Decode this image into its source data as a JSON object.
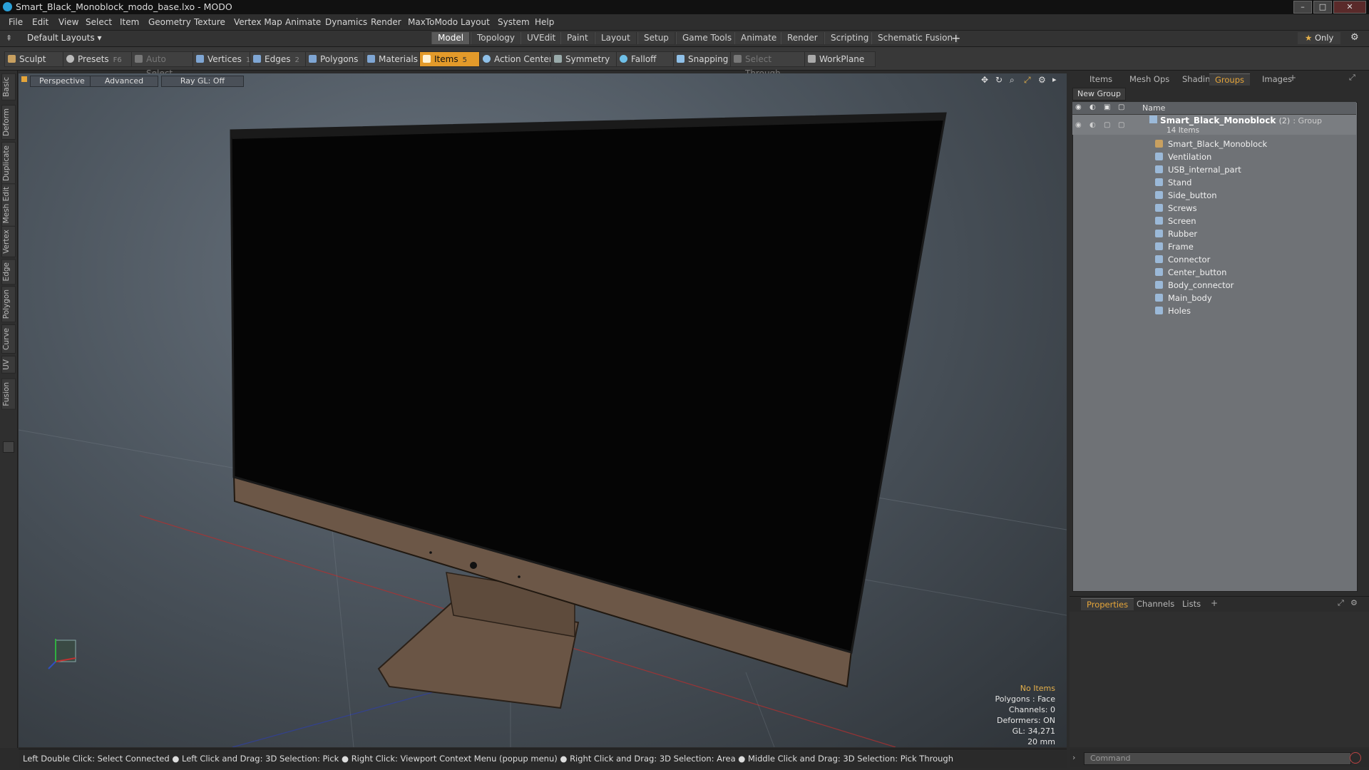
{
  "window": {
    "title": "Smart_Black_Monoblock_modo_base.lxo - MODO"
  },
  "menu": [
    "File",
    "Edit",
    "View",
    "Select",
    "Item",
    "Geometry",
    "Texture",
    "Vertex Map",
    "Animate",
    "Dynamics",
    "Render",
    "MaxToModo",
    "Layout",
    "System",
    "Help"
  ],
  "layout": {
    "preset": "Default Layouts",
    "tabs": [
      "Model",
      "Topology",
      "UVEdit",
      "Paint",
      "Layout",
      "Setup",
      "Game Tools",
      "Animate",
      "Render",
      "Scripting",
      "Schematic Fusion"
    ],
    "active_tab": "Model",
    "only_label": "Only"
  },
  "toolbar": {
    "sculpt": "Sculpt",
    "presets": "Presets",
    "presets_key": "F6",
    "auto_select": "Auto Select",
    "vertices": "Vertices",
    "vertices_key": "1",
    "edges": "Edges",
    "edges_key": "2",
    "polygons": "Polygons",
    "materials": "Materials",
    "items": "Items",
    "items_key": "5",
    "action_center": "Action Center",
    "symmetry": "Symmetry",
    "falloff": "Falloff",
    "snapping": "Snapping",
    "select_through": "Select Through",
    "workplane": "WorkPlane"
  },
  "left_tabs": [
    "Basic",
    "Deform",
    "Duplicate",
    "Mesh Edit",
    "Vertex",
    "Edge",
    "Polygon",
    "Curve",
    "UV",
    "Fusion"
  ],
  "viewport": {
    "perspective": "Perspective",
    "advanced": "Advanced",
    "raygl": "Ray GL: Off",
    "hud": {
      "no_items": "No Items",
      "polygons": "Polygons : Face",
      "channels": "Channels: 0",
      "deformers": "Deformers: ON",
      "gl": "GL: 34,271",
      "scale": "20 mm"
    }
  },
  "status": "Left Double Click: Select Connected ● Left Click and Drag: 3D Selection: Pick ● Right Click: Viewport Context Menu (popup menu) ● Right Click and Drag: 3D Selection: Area ● Middle Click and Drag: 3D Selection: Pick Through",
  "right_panel": {
    "tabs": [
      "Items",
      "Mesh Ops",
      "Shading",
      "Groups",
      "Images"
    ],
    "active_tab": "Groups",
    "new_group": "New Group",
    "name_header": "Name",
    "group": {
      "name": "Smart_Black_Monoblock",
      "count": "(2)",
      "type": ": Group",
      "items_label": "14 Items"
    },
    "items": [
      "Smart_Black_Monoblock",
      "Ventilation",
      "USB_internal_part",
      "Stand",
      "Side_button",
      "Screws",
      "Screen",
      "Rubber",
      "Frame",
      "Connector",
      "Center_button",
      "Body_connector",
      "Main_body",
      "Holes"
    ]
  },
  "props_panel": {
    "tabs": [
      "Properties",
      "Channels",
      "Lists"
    ],
    "active_tab": "Properties"
  },
  "command": {
    "placeholder": "Command"
  }
}
